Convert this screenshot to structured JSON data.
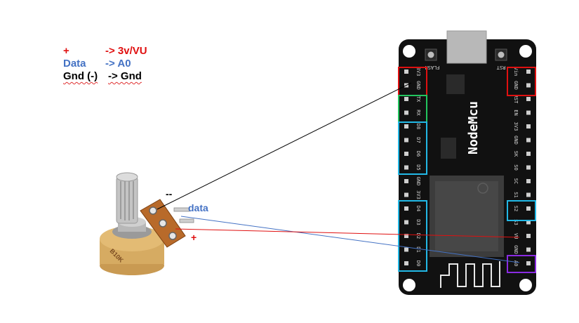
{
  "legend": {
    "rows": [
      {
        "left": "+",
        "right": "-> 3v/VU",
        "color": "#e01010"
      },
      {
        "left": "Data",
        "right": "-> A0",
        "color": "#4472c4"
      },
      {
        "left": "Gnd (-)",
        "right": "-> Gnd",
        "color": "#000000"
      }
    ]
  },
  "board": {
    "name": "NodeMcu",
    "flash_label": "FLASH",
    "rst_label": "RST",
    "left_pins": [
      "3V3",
      "GND",
      "TX",
      "RX",
      "D8",
      "D7",
      "D6",
      "D5",
      "GND",
      "3V3",
      "D4",
      "D3",
      "D2",
      "D1",
      "D0"
    ],
    "right_pins": [
      "Vin",
      "GND",
      "RST",
      "EN",
      "3V3",
      "GND",
      "SK",
      "SO",
      "SC",
      "S1",
      "S2",
      "S3",
      "VU",
      "GND",
      "A0"
    ]
  },
  "pot": {
    "body_text": "B10K",
    "labels": {
      "minus": "--",
      "data": "data",
      "plus": "+"
    }
  },
  "colors": {
    "gnd_wire": "#000000",
    "data_wire": "#4472c4",
    "vcc_wire": "#e01010",
    "box_red": "#e01010",
    "box_green": "#22c55e",
    "box_cyan": "#22b8e6",
    "box_purple": "#8a2be2"
  }
}
